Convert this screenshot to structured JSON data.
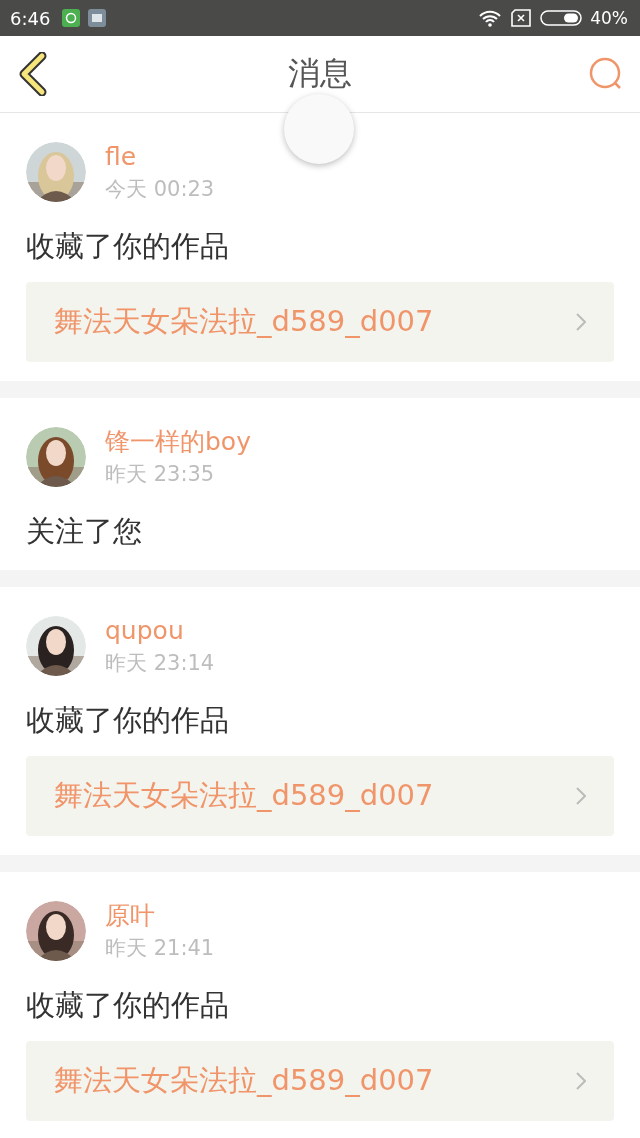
{
  "status_bar": {
    "time": "6:46",
    "battery": "40%"
  },
  "header": {
    "title": "消息"
  },
  "messages": [
    {
      "user": "fle",
      "time": "今天 00:23",
      "action": "收藏了你的作品",
      "work": "舞法天女朵法拉_d589_d007"
    },
    {
      "user": "锋一样的boy",
      "time": "昨天 23:35",
      "action": "关注了您"
    },
    {
      "user": "qupou",
      "time": "昨天 23:14",
      "action": "收藏了你的作品",
      "work": "舞法天女朵法拉_d589_d007"
    },
    {
      "user": "原叶",
      "time": "昨天 21:41",
      "action": "收藏了你的作品",
      "work": "舞法天女朵法拉_d589_d007"
    }
  ]
}
